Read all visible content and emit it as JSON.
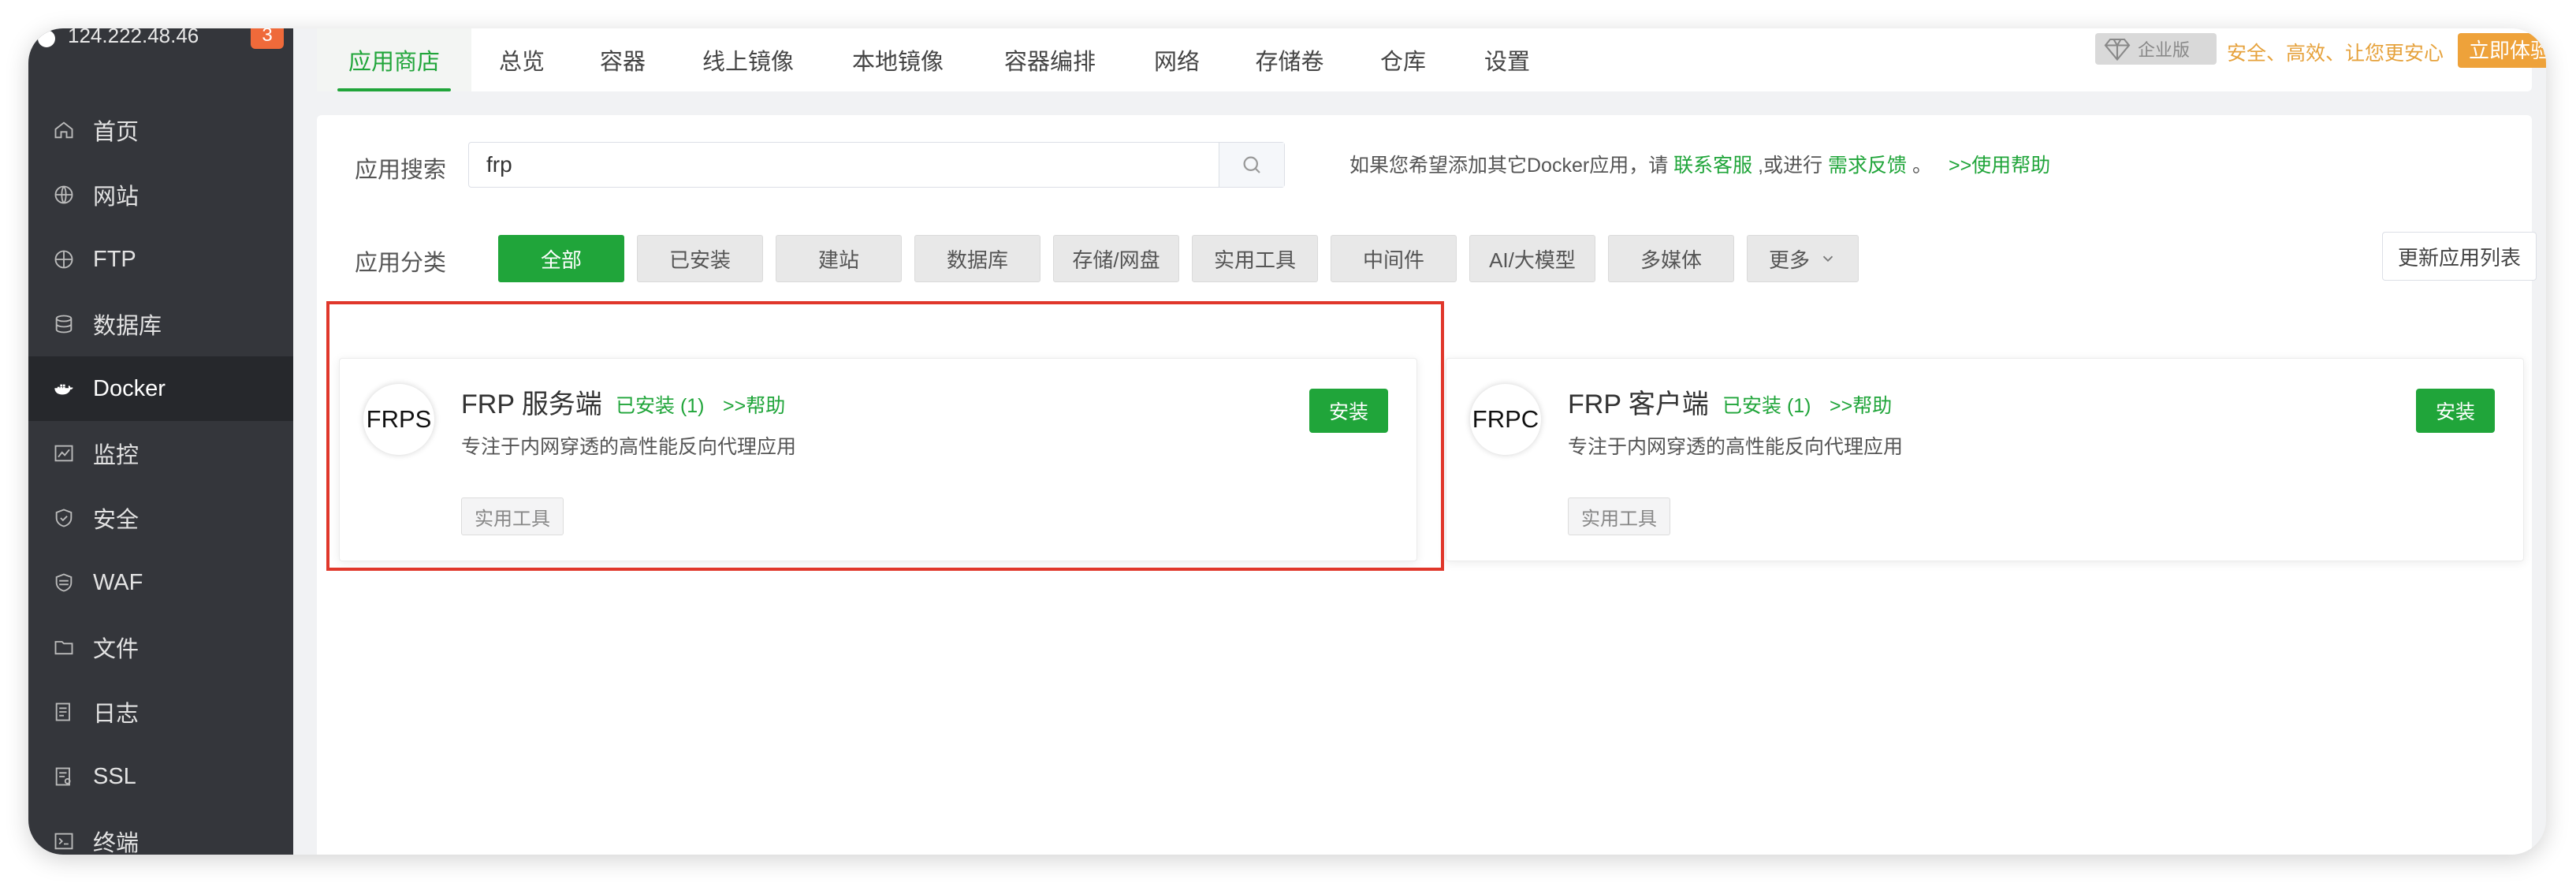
{
  "colors": {
    "brand": "#20a53a",
    "sidebar": "#34363b",
    "highlight": "#e0372b",
    "enterprise": "#eea23a"
  },
  "sidebar": {
    "server_ip": "124.222.48.46",
    "notification_count": "3",
    "items": [
      {
        "label": "首页",
        "icon": "home-icon"
      },
      {
        "label": "网站",
        "icon": "globe-icon"
      },
      {
        "label": "FTP",
        "icon": "ftp-globe-icon"
      },
      {
        "label": "数据库",
        "icon": "database-icon"
      },
      {
        "label": "Docker",
        "icon": "docker-icon",
        "active": true
      },
      {
        "label": "监控",
        "icon": "monitor-chart-icon"
      },
      {
        "label": "安全",
        "icon": "shield-icon"
      },
      {
        "label": "WAF",
        "icon": "waf-shield-icon"
      },
      {
        "label": "文件",
        "icon": "folder-icon"
      },
      {
        "label": "日志",
        "icon": "log-icon"
      },
      {
        "label": "SSL",
        "icon": "ssl-certificate-icon"
      },
      {
        "label": "终端",
        "icon": "terminal-icon"
      }
    ]
  },
  "tabs": [
    "应用商店",
    "总览",
    "容器",
    "线上镜像",
    "本地镜像",
    "容器编排",
    "网络",
    "存储卷",
    "仓库",
    "设置"
  ],
  "active_tab": "应用商店",
  "enterprise": {
    "badge": "企业版",
    "slogan": "安全、高效、让您更安心",
    "trial": "立即体验"
  },
  "search": {
    "label": "应用搜索",
    "value": "frp"
  },
  "hint": {
    "prefix": "如果您希望添加其它Docker应用，请",
    "contact": "联系客服",
    "middle": ",或进行",
    "feedback": "需求反馈",
    "suffix": "。",
    "help": ">>使用帮助"
  },
  "category": {
    "label": "应用分类",
    "items": [
      "全部",
      "已安装",
      "建站",
      "数据库",
      "存储/网盘",
      "实用工具",
      "中间件",
      "AI/大模型",
      "多媒体",
      "更多"
    ],
    "active": "全部",
    "refresh": "更新应用列表"
  },
  "apps": [
    {
      "logo": "FRPS",
      "name": "FRP 服务端",
      "installed": "已安装 (1)",
      "help": ">>帮助",
      "desc": "专注于内网穿透的高性能反向代理应用",
      "tag": "实用工具",
      "action": "安装"
    },
    {
      "logo": "FRPC",
      "name": "FRP 客户端",
      "installed": "已安装 (1)",
      "help": ">>帮助",
      "desc": "专注于内网穿透的高性能反向代理应用",
      "tag": "实用工具",
      "action": "安装"
    }
  ]
}
